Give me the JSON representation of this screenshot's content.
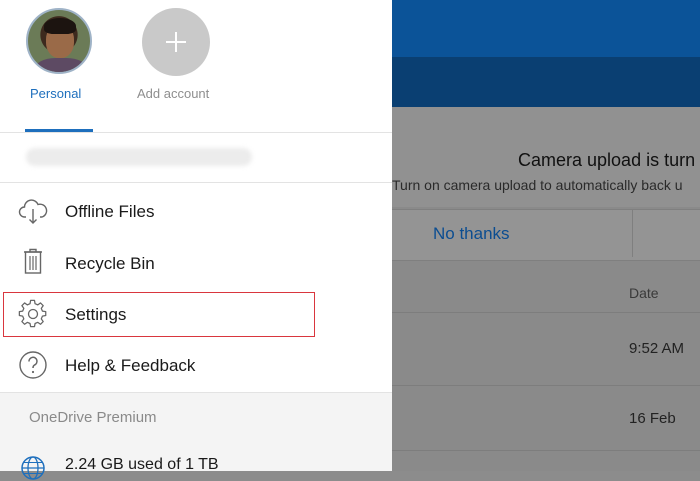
{
  "drawer": {
    "accounts": [
      {
        "label": "Personal",
        "icon": "avatar"
      },
      {
        "label": "Add account",
        "icon": "plus-icon"
      }
    ],
    "menu": [
      {
        "label": "Offline Files",
        "icon": "cloud-download-icon"
      },
      {
        "label": "Recycle Bin",
        "icon": "trash-icon"
      },
      {
        "label": "Settings",
        "icon": "gear-icon"
      },
      {
        "label": "Help & Feedback",
        "icon": "help-icon"
      }
    ],
    "premium_label": "OneDrive Premium",
    "storage_label": "2.24 GB used of 1 TB",
    "accent_color": "#1e6fbd",
    "highlight_color": "#d9363e"
  },
  "background": {
    "banner_title": "Camera upload is turn",
    "banner_text": "Turn on camera upload to automatically back u",
    "no_thanks": "No thanks",
    "column_header": "Date",
    "rows": [
      {
        "date": "9:52 AM"
      },
      {
        "date": "16 Feb"
      }
    ],
    "header_color": "#0b5398"
  }
}
